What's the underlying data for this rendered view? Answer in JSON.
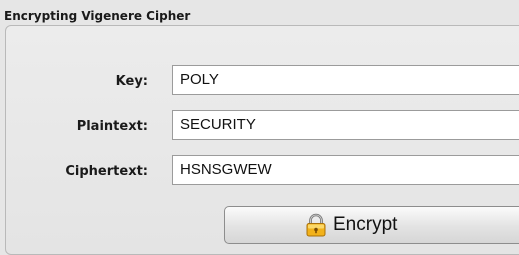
{
  "group": {
    "title": "Encrypting Vigenere Cipher"
  },
  "form": {
    "key_label": "Key:",
    "key_value": "POLY",
    "plaintext_label": "Plaintext:",
    "plaintext_value": "SECURITY",
    "ciphertext_label": "Ciphertext:",
    "ciphertext_value": "HSNSGWEW"
  },
  "button": {
    "label": "Encrypt",
    "icon": "lock-icon"
  }
}
